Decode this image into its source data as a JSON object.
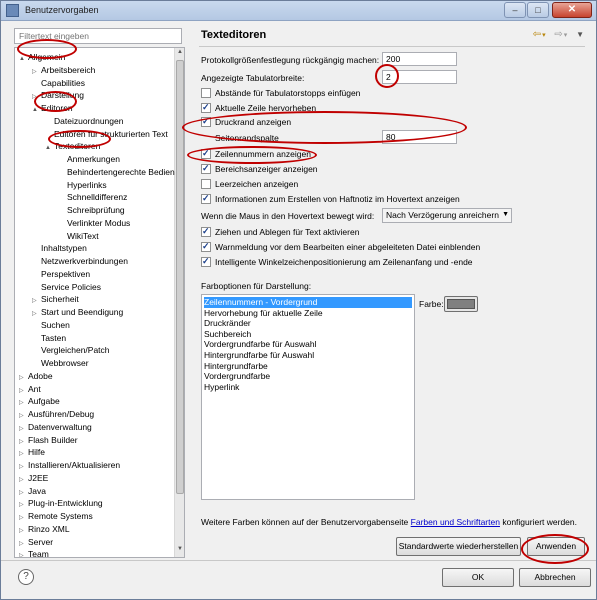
{
  "window": {
    "title": "Benutzervorgaben"
  },
  "filter": {
    "placeholder": "Filtertext eingeben"
  },
  "tree": [
    {
      "label": "Allgemein",
      "indent": 0,
      "expander": "▲"
    },
    {
      "label": "Arbeitsbereich",
      "indent": 1,
      "expander": "▷"
    },
    {
      "label": "Capabilities",
      "indent": 1,
      "expander": ""
    },
    {
      "label": "Darstellung",
      "indent": 1,
      "expander": "▷"
    },
    {
      "label": "Editoren",
      "indent": 1,
      "expander": "▲"
    },
    {
      "label": "Dateizuordnungen",
      "indent": 2,
      "expander": ""
    },
    {
      "label": "Editoren für strukturierten Text",
      "indent": 2,
      "expander": ""
    },
    {
      "label": "Texteditoren",
      "indent": 2,
      "expander": "▲"
    },
    {
      "label": "Anmerkungen",
      "indent": 3,
      "expander": ""
    },
    {
      "label": "Behindertengerechte Bedien",
      "indent": 3,
      "expander": ""
    },
    {
      "label": "Hyperlinks",
      "indent": 3,
      "expander": ""
    },
    {
      "label": "Schnelldifferenz",
      "indent": 3,
      "expander": ""
    },
    {
      "label": "Schreibprüfung",
      "indent": 3,
      "expander": ""
    },
    {
      "label": "Verlinkter Modus",
      "indent": 3,
      "expander": ""
    },
    {
      "label": "WikiText",
      "indent": 3,
      "expander": ""
    },
    {
      "label": "Inhaltstypen",
      "indent": 1,
      "expander": ""
    },
    {
      "label": "Netzwerkverbindungen",
      "indent": 1,
      "expander": ""
    },
    {
      "label": "Perspektiven",
      "indent": 1,
      "expander": ""
    },
    {
      "label": "Service Policies",
      "indent": 1,
      "expander": ""
    },
    {
      "label": "Sicherheit",
      "indent": 1,
      "expander": "▷"
    },
    {
      "label": "Start und Beendigung",
      "indent": 1,
      "expander": "▷"
    },
    {
      "label": "Suchen",
      "indent": 1,
      "expander": ""
    },
    {
      "label": "Tasten",
      "indent": 1,
      "expander": ""
    },
    {
      "label": "Vergleichen/Patch",
      "indent": 1,
      "expander": ""
    },
    {
      "label": "Webbrowser",
      "indent": 1,
      "expander": ""
    },
    {
      "label": "Adobe",
      "indent": 0,
      "expander": "▷"
    },
    {
      "label": "Ant",
      "indent": 0,
      "expander": "▷"
    },
    {
      "label": "Aufgabe",
      "indent": 0,
      "expander": "▷"
    },
    {
      "label": "Ausführen/Debug",
      "indent": 0,
      "expander": "▷"
    },
    {
      "label": "Datenverwaltung",
      "indent": 0,
      "expander": "▷"
    },
    {
      "label": "Flash Builder",
      "indent": 0,
      "expander": "▷"
    },
    {
      "label": "Hilfe",
      "indent": 0,
      "expander": "▷"
    },
    {
      "label": "Installieren/Aktualisieren",
      "indent": 0,
      "expander": "▷"
    },
    {
      "label": "J2EE",
      "indent": 0,
      "expander": "▷"
    },
    {
      "label": "Java",
      "indent": 0,
      "expander": "▷"
    },
    {
      "label": "Plug-in-Entwicklung",
      "indent": 0,
      "expander": "▷"
    },
    {
      "label": "Remote Systems",
      "indent": 0,
      "expander": "▷"
    },
    {
      "label": "Rinzo XML",
      "indent": 0,
      "expander": "▷"
    },
    {
      "label": "Server",
      "indent": 0,
      "expander": "▷"
    },
    {
      "label": "Team",
      "indent": 0,
      "expander": "▷"
    }
  ],
  "panel": {
    "title": "Texteditoren",
    "undo_label": "Protokollgrößenfestlegung rückgängig machen:",
    "undo_value": "200",
    "tab_label": "Angezeigte Tabulatorbreite:",
    "tab_value": "2",
    "cb_tabstops": "Abstände für Tabulatorstopps einfügen",
    "cb_current_line": "Aktuelle Zeile hervorheben",
    "cb_print_margin": "Druckrand anzeigen",
    "margin_label": "Seitenrandspalte",
    "margin_value": "80",
    "cb_line_numbers": "Zeilennummern anzeigen",
    "cb_range": "Bereichsanzeiger anzeigen",
    "cb_whitespace": "Leerzeichen anzeigen",
    "cb_hover_info": "Informationen zum Erstellen von Haftnotiz im Hovertext anzeigen",
    "hover_label": "Wenn die Maus in den Hovertext bewegt wird:",
    "hover_value": "Nach Verzögerung anreichern",
    "cb_dragdrop": "Ziehen und Ablegen für Text aktivieren",
    "cb_warn_derived": "Warnmeldung vor dem Bearbeiten einer abgeleiteten Datei einblenden",
    "cb_smart_caret": "Intelligente Winkelzeichenpositionierung am Zeilenanfang und -ende",
    "color_options_label": "Farboptionen für Darstellung:",
    "color_label": "Farbe:",
    "color_options": [
      "Zeilennummern - Vordergrund",
      "Hervorhebung für aktuelle Zeile",
      "Druckränder",
      "Suchbereich",
      "Vordergrundfarbe für Auswahl",
      "Hintergrundfarbe für Auswahl",
      "Hintergrundfarbe",
      "Vordergrundfarbe",
      "Hyperlink"
    ],
    "footer_pre": "Weitere Farben können auf der Benutzervorgabenseite",
    "footer_link": "Farben und Schriftarten",
    "footer_post": "konfiguriert werden.",
    "restore_button": "Standardwerte wiederherstellen",
    "apply_button": "Anwenden"
  },
  "dialog": {
    "ok_button": "OK",
    "cancel_button": "Abbrechen"
  },
  "colors": {
    "annotation": "#c00000",
    "selection": "#3399ff",
    "swatch": "#808080"
  }
}
